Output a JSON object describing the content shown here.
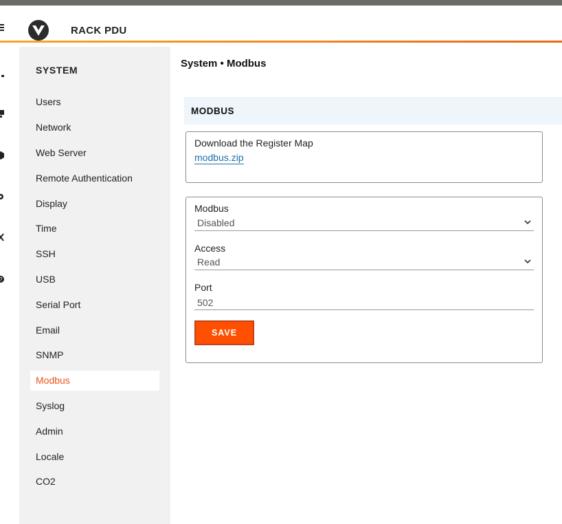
{
  "header": {
    "app_title": "RACK PDU"
  },
  "rail_icons": [
    "network-icon",
    "device-icon",
    "cube-icon",
    "gear-icon",
    "tools-icon",
    "help-icon"
  ],
  "sidebar": {
    "heading": "SYSTEM",
    "items": [
      {
        "label": "Users"
      },
      {
        "label": "Network"
      },
      {
        "label": "Web Server"
      },
      {
        "label": "Remote Authentication"
      },
      {
        "label": "Display"
      },
      {
        "label": "Time"
      },
      {
        "label": "SSH"
      },
      {
        "label": "USB"
      },
      {
        "label": "Serial Port"
      },
      {
        "label": "Email"
      },
      {
        "label": "SNMP"
      },
      {
        "label": "Modbus",
        "active": true
      },
      {
        "label": "Syslog"
      },
      {
        "label": "Admin"
      },
      {
        "label": "Locale"
      },
      {
        "label": "CO2"
      }
    ]
  },
  "main": {
    "breadcrumb": "System • Modbus",
    "section_title": "MODBUS",
    "download": {
      "label": "Download the Register Map",
      "link_text": "modbus.zip"
    },
    "form": {
      "modbus": {
        "label": "Modbus",
        "value": "Disabled"
      },
      "access": {
        "label": "Access",
        "value": "Read"
      },
      "port": {
        "label": "Port",
        "value": "502"
      },
      "save_label": "SAVE"
    }
  },
  "colors": {
    "accent": "#fe5000",
    "active_nav": "#e8561a",
    "link": "#1b6fa8",
    "section_bg": "#eef5fb",
    "sidebar_bg": "#f1f1f1"
  }
}
